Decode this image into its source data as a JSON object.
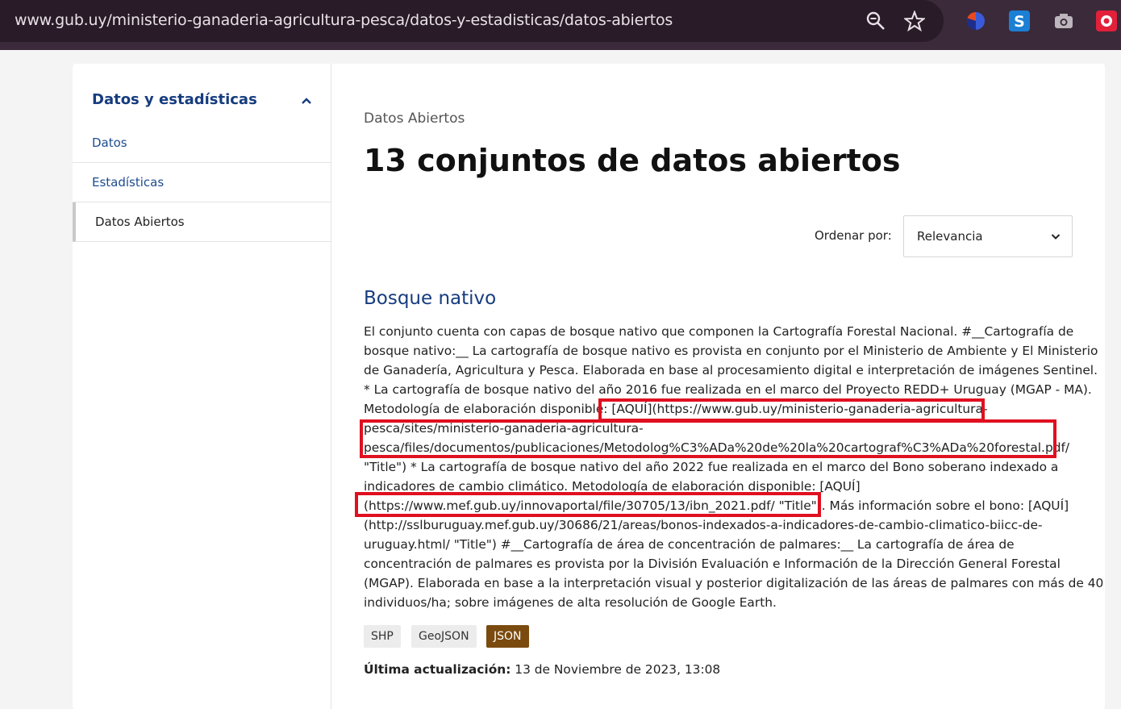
{
  "browser": {
    "url": "www.gub.uy/ministerio-ganaderia-agricultura-pesca/datos-y-estadisticas/datos-abiertos",
    "zoom_icon": "zoom-icon",
    "bookmark_icon": "star-icon"
  },
  "sidebar": {
    "title": "Datos y estadísticas",
    "items": [
      {
        "label": "Datos"
      },
      {
        "label": "Estadísticas"
      },
      {
        "label": "Datos Abiertos"
      }
    ]
  },
  "main": {
    "breadcrumb": "Datos Abiertos",
    "title": "13 conjuntos de datos abiertos",
    "sort_label": "Ordenar por:",
    "sort_value": "Relevancia"
  },
  "dataset": {
    "title": "Bosque nativo",
    "lines": [
      "El conjunto cuenta con capas de bosque nativo que componen la Cartografía Forestal Nacional. #__Cartografía de",
      "bosque nativo:__ La cartografía de bosque nativo es provista en conjunto por el Ministerio de Ambiente y El Ministerio",
      "de Ganadería, Agricultura y Pesca. Elaborada en base al procesamiento digital e interpretación de imágenes Sentinel.",
      "* La cartografía de bosque nativo del año 2016 fue realizada en el marco del Proyecto REDD+ Uruguay (MGAP - MA).",
      "Metodología de elaboración disponible: [AQUÍ](https://www.gub.uy/ministerio-ganaderia-agricultura-",
      "pesca/sites/ministerio-ganaderia-agricultura-",
      "pesca/files/documentos/publicaciones/Metodolog%C3%ADa%20de%20la%20cartograf%C3%ADa%20forestal.pdf/",
      "\"Title\") * La cartografía de bosque nativo del año 2022 fue realizada en el marco del Bono soberano indexado a",
      "indicadores de cambio climático. Metodología de elaboración disponible: [AQUÍ]",
      "(https://www.mef.gub.uy/innovaportal/file/30705/13/ibn_2021.pdf/ \"Title\"). Más información sobre el bono: [AQUÍ]",
      "(http://sslburuguay.mef.gub.uy/30686/21/areas/bonos-indexados-a-indicadores-de-cambio-climatico-biicc-de-",
      "uruguay.html/ \"Title\") #__Cartografía de área de concentración de palmares:__ La cartografía de área de",
      "concentración de palmares es provista por la División Evaluación e Información de la Dirección General Forestal",
      "(MGAP). Elaborada en base a la interpretación visual y posterior digitalización de las áreas de palmares con más de 40",
      "individuos/ha; sobre imágenes de alta resolución de Google Earth."
    ],
    "formats": [
      "SHP",
      "GeoJSON",
      "JSON"
    ],
    "updated_label": "Última actualización:",
    "updated_value": "13 de Noviembre de 2023, 13:08"
  },
  "colors": {
    "accent": "#163c7e",
    "highlight": "#e01020",
    "json_tag": "#7a4a0e"
  }
}
